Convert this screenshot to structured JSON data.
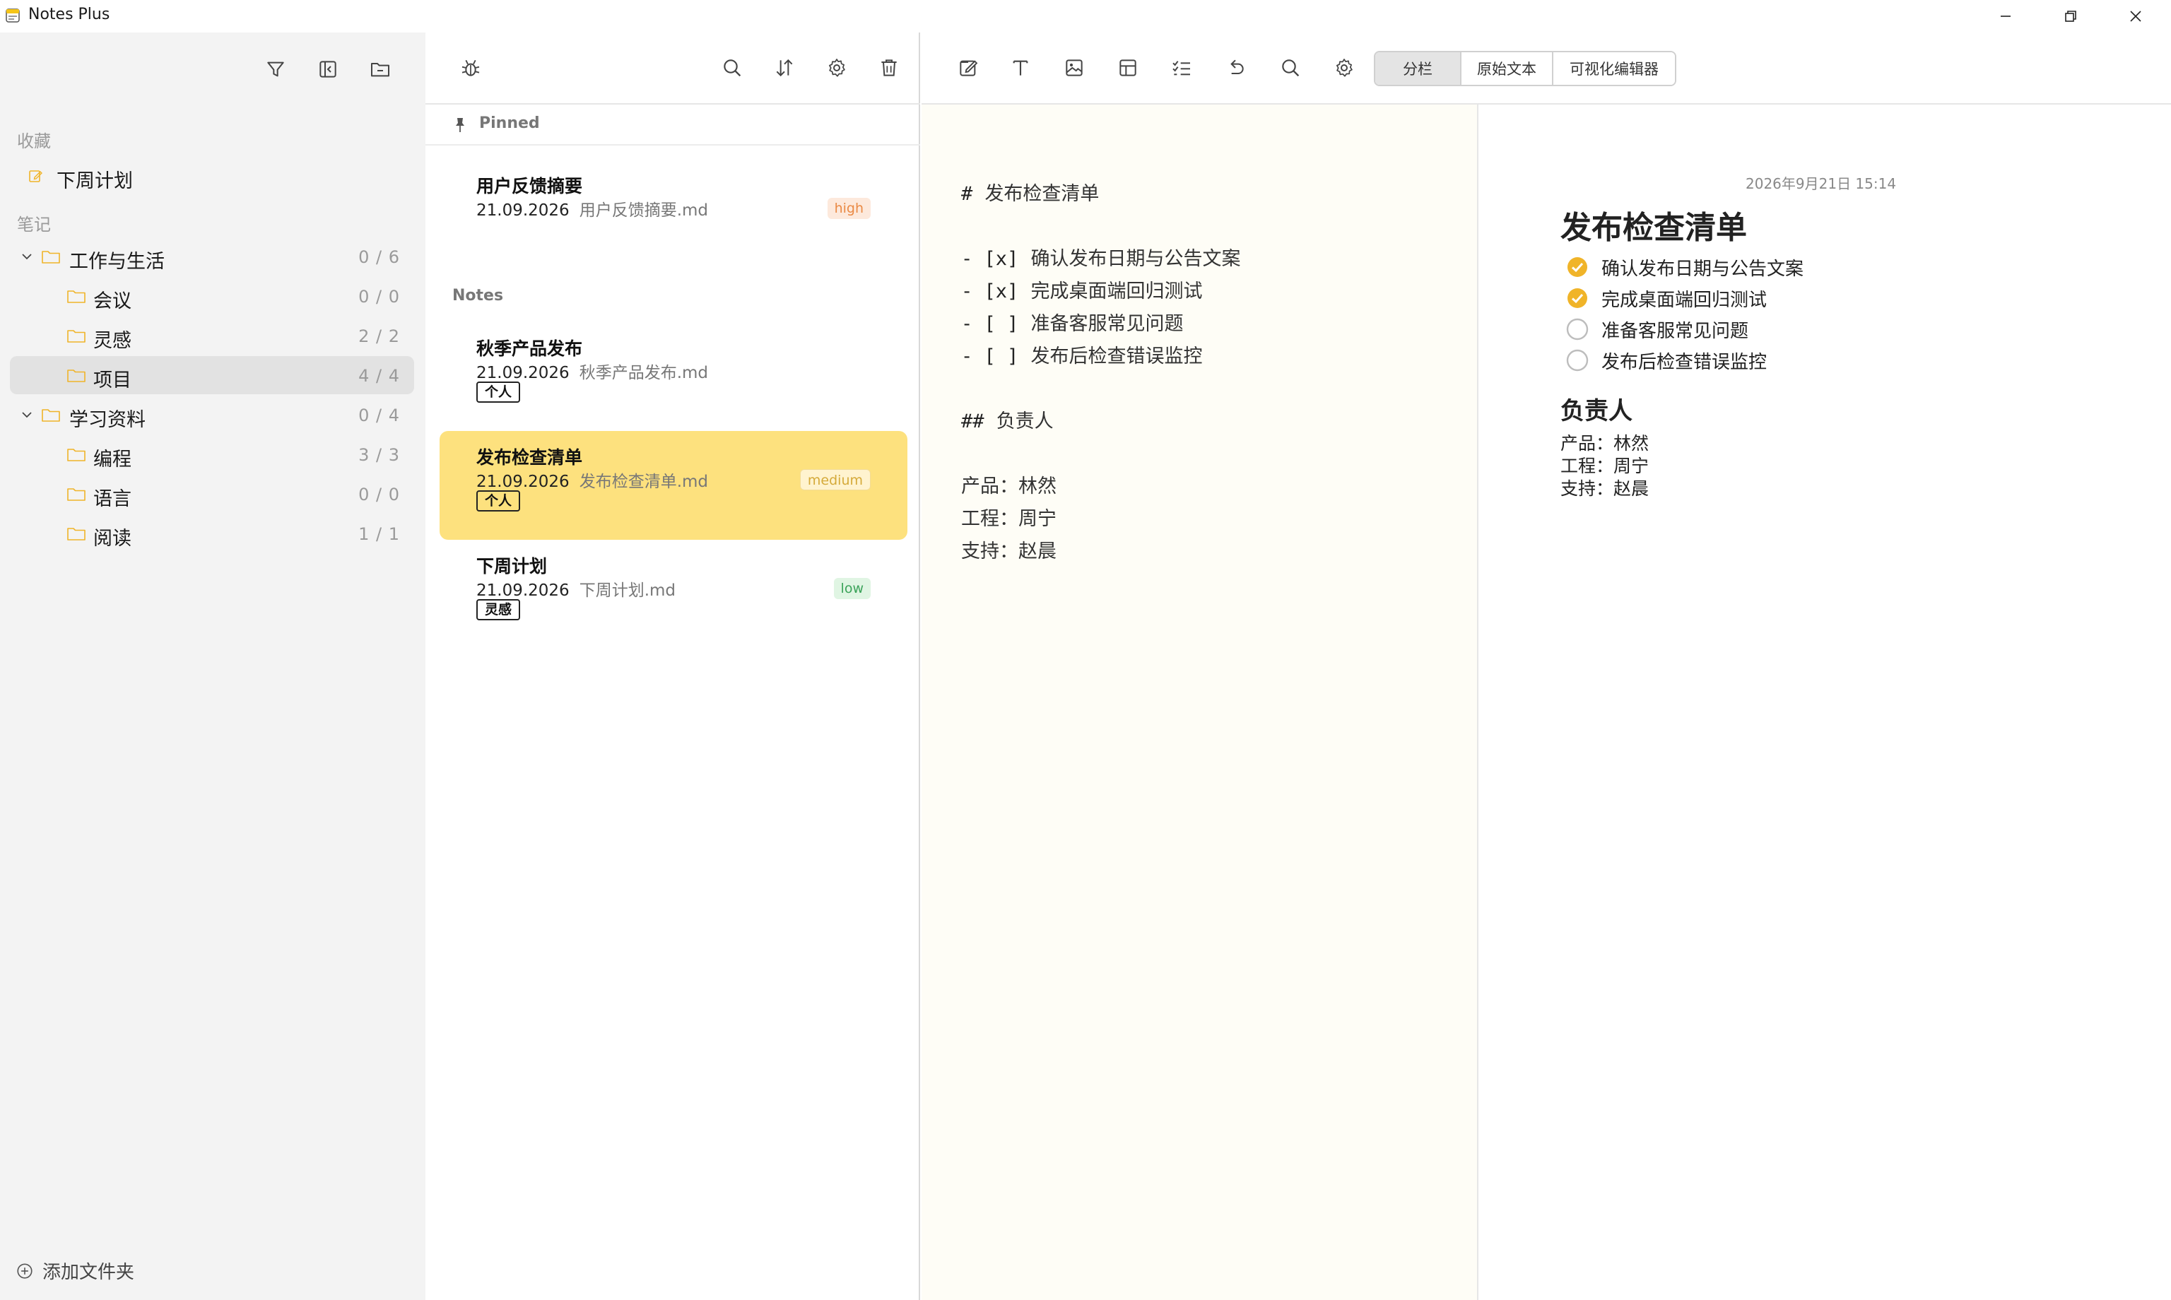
{
  "window": {
    "title": "Notes Plus"
  },
  "sidebar": {
    "favorites_label": "收藏",
    "favorites": [
      {
        "label": "下周计划"
      }
    ],
    "notes_label": "笔记",
    "tree": [
      {
        "label": "工作与生活",
        "count": "0 / 6"
      },
      {
        "label": "会议",
        "count": "0 / 0"
      },
      {
        "label": "灵感",
        "count": "2 / 2"
      },
      {
        "label": "项目",
        "count": "4 / 4"
      },
      {
        "label": "学习资料",
        "count": "0 / 4"
      },
      {
        "label": "编程",
        "count": "3 / 3"
      },
      {
        "label": "语言",
        "count": "0 / 0"
      },
      {
        "label": "阅读",
        "count": "1 / 1"
      }
    ],
    "add_folder_label": "添加文件夹"
  },
  "notes": {
    "pinned_label": "Pinned",
    "notes_label": "Notes",
    "pinned": [
      {
        "title": "用户反馈摘要",
        "date": "21.09.2026",
        "file": "用户反馈摘要.md",
        "priority": "high"
      }
    ],
    "items": [
      {
        "title": "秋季产品发布",
        "date": "21.09.2026",
        "file": "秋季产品发布.md",
        "tag": "个人"
      },
      {
        "title": "发布检查清单",
        "date": "21.09.2026",
        "file": "发布检查清单.md",
        "tag": "个人",
        "priority": "medium"
      },
      {
        "title": "下周计划",
        "date": "21.09.2026",
        "file": "下周计划.md",
        "tag": "灵感",
        "priority": "low"
      }
    ]
  },
  "editor": {
    "modes": [
      "分栏",
      "原始文本",
      "可视化编辑器"
    ],
    "active_mode": "分栏",
    "raw": {
      "h1_marker": "#",
      "h1_text": "发布检查清单",
      "tasks": [
        {
          "marker": "- [x]",
          "text": "确认发布日期与公告文案"
        },
        {
          "marker": "- [x]",
          "text": "完成桌面端回归测试"
        },
        {
          "marker": "- [ ]",
          "text": "准备客服常见问题"
        },
        {
          "marker": "- [ ]",
          "text": "发布后检查错误监控"
        }
      ],
      "h2_marker": "##",
      "h2_text": "负责人",
      "lines": [
        "产品：林然",
        "工程：周宁",
        "支持：赵晨"
      ]
    },
    "preview": {
      "date": "2026年9月21日 15:14",
      "h1": "发布检查清单",
      "tasks": [
        {
          "text": "确认发布日期与公告文案",
          "done": true
        },
        {
          "text": "完成桌面端回归测试",
          "done": true
        },
        {
          "text": "准备客服常见问题",
          "done": false
        },
        {
          "text": "发布后检查错误监控",
          "done": false
        }
      ],
      "h2": "负责人",
      "lines": [
        "产品：林然",
        "工程：周宁",
        "支持：赵晨"
      ]
    }
  },
  "colors": {
    "accent": "#fde17e",
    "check": "#f0b429",
    "sidebar_bg": "#f3f3f3",
    "editor_bg": "#fefdf6"
  }
}
